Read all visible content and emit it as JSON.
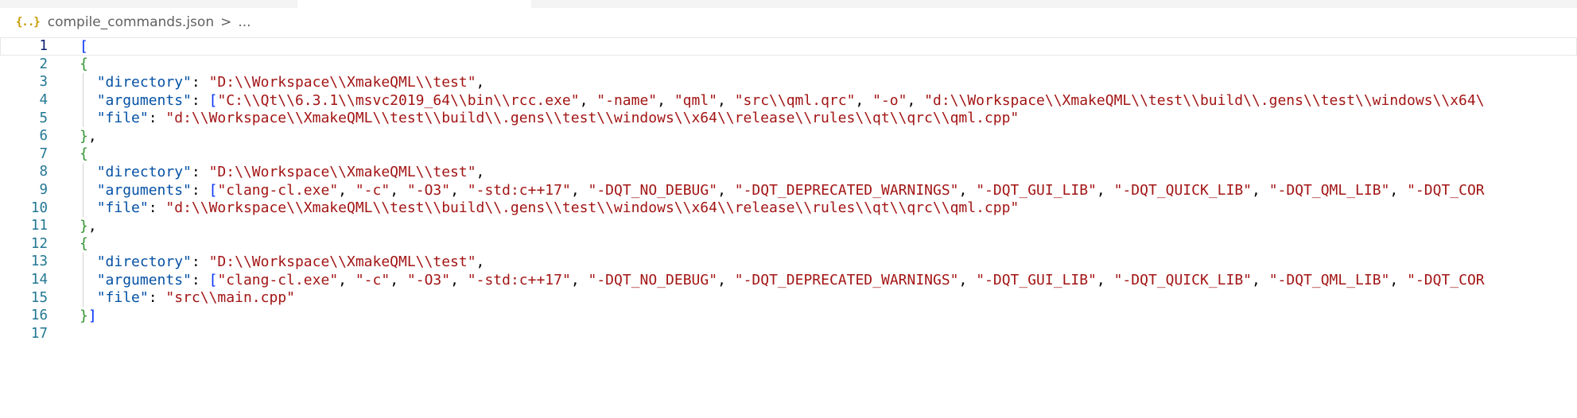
{
  "breadcrumb": {
    "icon": "json-file-icon",
    "icon_glyph": "{..}",
    "file": "compile_commands.json",
    "separator": ">",
    "more": "..."
  },
  "editor": {
    "line_numbers": [
      "1",
      "2",
      "3",
      "4",
      "5",
      "6",
      "7",
      "8",
      "9",
      "10",
      "11",
      "12",
      "13",
      "14",
      "15",
      "16",
      "17"
    ],
    "lines": [
      [
        {
          "t": "[",
          "c": "p-bracket1"
        }
      ],
      [
        {
          "t": "{",
          "c": "p-bracket2"
        }
      ],
      [
        {
          "t": "  "
        },
        {
          "t": "\"directory\"",
          "c": "p-key"
        },
        {
          "t": ": ",
          "c": "p-punc"
        },
        {
          "t": "\"D:\\\\Workspace\\\\XmakeQML\\\\test\"",
          "c": "p-str"
        },
        {
          "t": ",",
          "c": "p-punc"
        }
      ],
      [
        {
          "t": "  "
        },
        {
          "t": "\"arguments\"",
          "c": "p-key"
        },
        {
          "t": ": ",
          "c": "p-punc"
        },
        {
          "t": "[",
          "c": "p-bracket1"
        },
        {
          "t": "\"C:\\\\Qt\\\\6.3.1\\\\msvc2019_64\\\\bin\\\\rcc.exe\"",
          "c": "p-str"
        },
        {
          "t": ", ",
          "c": "p-punc"
        },
        {
          "t": "\"-name\"",
          "c": "p-str"
        },
        {
          "t": ", ",
          "c": "p-punc"
        },
        {
          "t": "\"qml\"",
          "c": "p-str"
        },
        {
          "t": ", ",
          "c": "p-punc"
        },
        {
          "t": "\"src\\\\qml.qrc\"",
          "c": "p-str"
        },
        {
          "t": ", ",
          "c": "p-punc"
        },
        {
          "t": "\"-o\"",
          "c": "p-str"
        },
        {
          "t": ", ",
          "c": "p-punc"
        },
        {
          "t": "\"d:\\\\Workspace\\\\XmakeQML\\\\test\\\\build\\\\.gens\\\\test\\\\windows\\\\x64\\",
          "c": "p-str"
        }
      ],
      [
        {
          "t": "  "
        },
        {
          "t": "\"file\"",
          "c": "p-key"
        },
        {
          "t": ": ",
          "c": "p-punc"
        },
        {
          "t": "\"d:\\\\Workspace\\\\XmakeQML\\\\test\\\\build\\\\.gens\\\\test\\\\windows\\\\x64\\\\release\\\\rules\\\\qt\\\\qrc\\\\qml.cpp\"",
          "c": "p-str"
        }
      ],
      [
        {
          "t": "}",
          "c": "p-bracket2"
        },
        {
          "t": ",",
          "c": "p-punc"
        }
      ],
      [
        {
          "t": "{",
          "c": "p-bracket2"
        }
      ],
      [
        {
          "t": "  "
        },
        {
          "t": "\"directory\"",
          "c": "p-key"
        },
        {
          "t": ": ",
          "c": "p-punc"
        },
        {
          "t": "\"D:\\\\Workspace\\\\XmakeQML\\\\test\"",
          "c": "p-str"
        },
        {
          "t": ",",
          "c": "p-punc"
        }
      ],
      [
        {
          "t": "  "
        },
        {
          "t": "\"arguments\"",
          "c": "p-key"
        },
        {
          "t": ": ",
          "c": "p-punc"
        },
        {
          "t": "[",
          "c": "p-bracket1"
        },
        {
          "t": "\"clang-cl.exe\"",
          "c": "p-str"
        },
        {
          "t": ", ",
          "c": "p-punc"
        },
        {
          "t": "\"-c\"",
          "c": "p-str"
        },
        {
          "t": ", ",
          "c": "p-punc"
        },
        {
          "t": "\"-O3\"",
          "c": "p-str"
        },
        {
          "t": ", ",
          "c": "p-punc"
        },
        {
          "t": "\"-std:c++17\"",
          "c": "p-str"
        },
        {
          "t": ", ",
          "c": "p-punc"
        },
        {
          "t": "\"-DQT_NO_DEBUG\"",
          "c": "p-str"
        },
        {
          "t": ", ",
          "c": "p-punc"
        },
        {
          "t": "\"-DQT_DEPRECATED_WARNINGS\"",
          "c": "p-str"
        },
        {
          "t": ", ",
          "c": "p-punc"
        },
        {
          "t": "\"-DQT_GUI_LIB\"",
          "c": "p-str"
        },
        {
          "t": ", ",
          "c": "p-punc"
        },
        {
          "t": "\"-DQT_QUICK_LIB\"",
          "c": "p-str"
        },
        {
          "t": ", ",
          "c": "p-punc"
        },
        {
          "t": "\"-DQT_QML_LIB\"",
          "c": "p-str"
        },
        {
          "t": ", ",
          "c": "p-punc"
        },
        {
          "t": "\"-DQT_COR",
          "c": "p-str"
        }
      ],
      [
        {
          "t": "  "
        },
        {
          "t": "\"file\"",
          "c": "p-key"
        },
        {
          "t": ": ",
          "c": "p-punc"
        },
        {
          "t": "\"d:\\\\Workspace\\\\XmakeQML\\\\test\\\\build\\\\.gens\\\\test\\\\windows\\\\x64\\\\release\\\\rules\\\\qt\\\\qrc\\\\qml.cpp\"",
          "c": "p-str"
        }
      ],
      [
        {
          "t": "}",
          "c": "p-bracket2"
        },
        {
          "t": ",",
          "c": "p-punc"
        }
      ],
      [
        {
          "t": "{",
          "c": "p-bracket2"
        }
      ],
      [
        {
          "t": "  "
        },
        {
          "t": "\"directory\"",
          "c": "p-key"
        },
        {
          "t": ": ",
          "c": "p-punc"
        },
        {
          "t": "\"D:\\\\Workspace\\\\XmakeQML\\\\test\"",
          "c": "p-str"
        },
        {
          "t": ",",
          "c": "p-punc"
        }
      ],
      [
        {
          "t": "  "
        },
        {
          "t": "\"arguments\"",
          "c": "p-key"
        },
        {
          "t": ": ",
          "c": "p-punc"
        },
        {
          "t": "[",
          "c": "p-bracket1"
        },
        {
          "t": "\"clang-cl.exe\"",
          "c": "p-str"
        },
        {
          "t": ", ",
          "c": "p-punc"
        },
        {
          "t": "\"-c\"",
          "c": "p-str"
        },
        {
          "t": ", ",
          "c": "p-punc"
        },
        {
          "t": "\"-O3\"",
          "c": "p-str"
        },
        {
          "t": ", ",
          "c": "p-punc"
        },
        {
          "t": "\"-std:c++17\"",
          "c": "p-str"
        },
        {
          "t": ", ",
          "c": "p-punc"
        },
        {
          "t": "\"-DQT_NO_DEBUG\"",
          "c": "p-str"
        },
        {
          "t": ", ",
          "c": "p-punc"
        },
        {
          "t": "\"-DQT_DEPRECATED_WARNINGS\"",
          "c": "p-str"
        },
        {
          "t": ", ",
          "c": "p-punc"
        },
        {
          "t": "\"-DQT_GUI_LIB\"",
          "c": "p-str"
        },
        {
          "t": ", ",
          "c": "p-punc"
        },
        {
          "t": "\"-DQT_QUICK_LIB\"",
          "c": "p-str"
        },
        {
          "t": ", ",
          "c": "p-punc"
        },
        {
          "t": "\"-DQT_QML_LIB\"",
          "c": "p-str"
        },
        {
          "t": ", ",
          "c": "p-punc"
        },
        {
          "t": "\"-DQT_COR",
          "c": "p-str"
        }
      ],
      [
        {
          "t": "  "
        },
        {
          "t": "\"file\"",
          "c": "p-key"
        },
        {
          "t": ": ",
          "c": "p-punc"
        },
        {
          "t": "\"src\\\\main.cpp\"",
          "c": "p-str"
        }
      ],
      [
        {
          "t": "}",
          "c": "p-bracket2"
        },
        {
          "t": "]",
          "c": "p-bracket1"
        }
      ],
      []
    ],
    "active_line": 1,
    "colors": {
      "line_number": "#237893",
      "line_number_active": "#0b216f",
      "key": "#0451a5",
      "string": "#a31515",
      "bracket_level1": "#0431fa",
      "bracket_level2": "#319331"
    }
  }
}
